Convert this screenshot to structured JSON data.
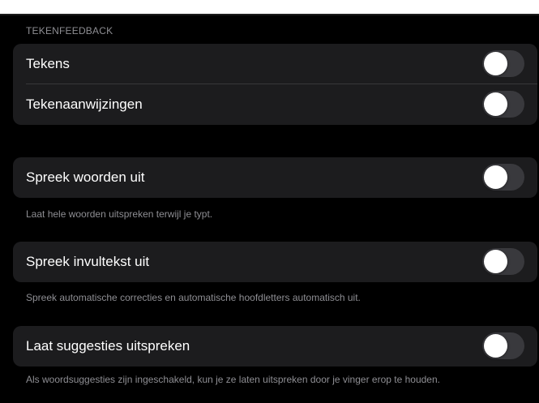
{
  "section": {
    "header": "TEKENFEEDBACK"
  },
  "rows": [
    {
      "label": "Tekens",
      "on": false
    },
    {
      "label": "Tekenaanwijzingen",
      "on": false
    },
    {
      "label": "Spreek woorden uit",
      "on": false,
      "footnote": "Laat hele woorden uitspreken terwijl je typt."
    },
    {
      "label": "Spreek invultekst uit",
      "on": false,
      "footnote": "Spreek automatische correcties en automatische hoofdletters automatisch uit."
    },
    {
      "label": "Laat suggesties uitspreken",
      "on": false,
      "footnote": "Als woordsuggesties zijn ingeschakeld, kun je ze laten uitspreken door je vinger erop te houden."
    }
  ],
  "colors": {
    "background": "#000000",
    "cell": "#1c1c1e",
    "toggle_off": "#39393d",
    "footnote": "#8e8e93"
  },
  "icons": {
    "toggle": "toggle-switch"
  }
}
